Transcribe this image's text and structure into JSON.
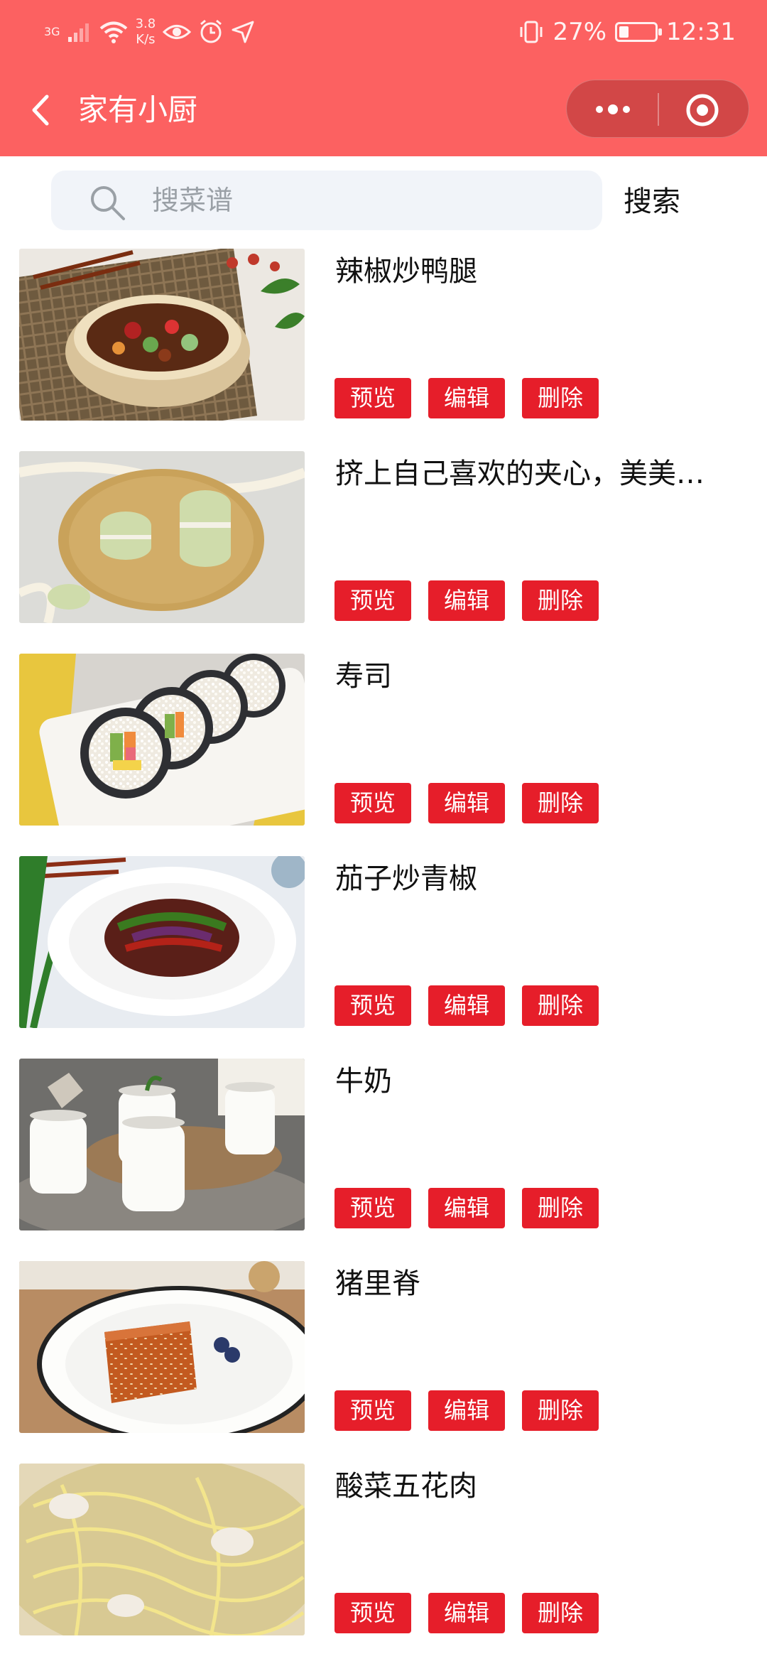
{
  "status_bar": {
    "network": "3G",
    "speed": "3.8",
    "speed_unit": "K/s",
    "battery_percent": "27%",
    "battery_level": 0.27,
    "time": "12:31",
    "icons": [
      "signal-icon",
      "wifi-icon",
      "eye-icon",
      "alarm-icon",
      "location-icon",
      "vibrate-icon",
      "battery-icon"
    ]
  },
  "nav": {
    "title": "家有小厨",
    "back_icon": "chevron-left-icon",
    "capsule_icons": [
      "more-icon",
      "target-icon"
    ]
  },
  "search": {
    "placeholder": "搜菜谱",
    "value": "",
    "button_label": "搜索"
  },
  "recipes": [
    {
      "title": "辣椒炒鸭腿",
      "preview": "预览",
      "edit": "编辑",
      "delete": "删除",
      "image": "casserole-duck-dish"
    },
    {
      "title": "挤上自己喜欢的夹心，美美…",
      "preview": "预览",
      "edit": "编辑",
      "delete": "删除",
      "image": "green-macarons"
    },
    {
      "title": "寿司",
      "preview": "预览",
      "edit": "编辑",
      "delete": "删除",
      "image": "sushi-rolls"
    },
    {
      "title": "茄子炒青椒",
      "preview": "预览",
      "edit": "编辑",
      "delete": "删除",
      "image": "eggplant-pepper-plate"
    },
    {
      "title": "牛奶",
      "preview": "预览",
      "edit": "编辑",
      "delete": "删除",
      "image": "milk-jars"
    },
    {
      "title": "猪里脊",
      "preview": "预览",
      "edit": "编辑",
      "delete": "删除",
      "image": "glazed-pork-plate"
    },
    {
      "title": "酸菜五花肉",
      "preview": "预览",
      "edit": "编辑",
      "delete": "删除",
      "image": "sauerkraut-pork"
    }
  ],
  "colors": {
    "header": "#fc6161",
    "button": "#e61e2a",
    "search_bg": "#f1f4f9"
  }
}
